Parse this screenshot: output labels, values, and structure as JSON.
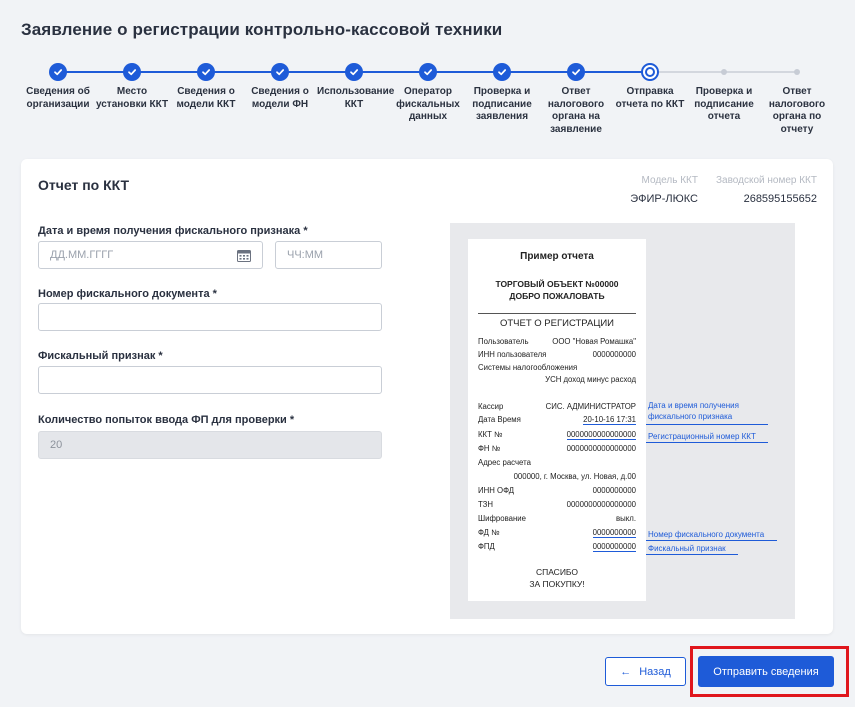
{
  "page_title": "Заявление о регистрации контрольно-кассовой техники",
  "steps": [
    {
      "label": "Сведения об организации",
      "status": "done"
    },
    {
      "label": "Место установки ККТ",
      "status": "done"
    },
    {
      "label": "Сведения о модели ККТ",
      "status": "done"
    },
    {
      "label": "Сведения о модели ФН",
      "status": "done"
    },
    {
      "label": "Использование ККТ",
      "status": "done"
    },
    {
      "label": "Оператор фискальных данных",
      "status": "done"
    },
    {
      "label": "Проверка и подписание заявления",
      "status": "done"
    },
    {
      "label": "Ответ налогового органа на заявление",
      "status": "done"
    },
    {
      "label": "Отправка отчета по ККТ",
      "status": "current"
    },
    {
      "label": "Проверка и подписание отчета",
      "status": "todo"
    },
    {
      "label": "Ответ налогового органа по отчету",
      "status": "todo"
    }
  ],
  "card": {
    "title": "Отчет по ККТ",
    "kkt_model_label": "Модель ККТ",
    "kkt_model_value": "ЭФИР-ЛЮКС",
    "serial_label": "Заводской номер ККТ",
    "serial_value": "268595155652"
  },
  "form": {
    "datetime_label": "Дата и время получения фискального признака *",
    "date_placeholder": "ДД.ММ.ГГГГ",
    "time_placeholder": "ЧЧ:ММ",
    "doc_number_label": "Номер фискального документа *",
    "fiscal_sign_label": "Фискальный признак *",
    "attempts_label": "Количество попыток ввода ФП для проверки *",
    "attempts_value": "20"
  },
  "receipt": {
    "title": "Пример отчета",
    "shop_line1": "ТОРГОВЫЙ ОБЪЕКТ №00000",
    "shop_line2": "ДОБРО ПОЖАЛОВАТЬ",
    "report_title": "ОТЧЕТ О РЕГИСТРАЦИИ",
    "user_label": "Пользователь",
    "user_value": "ООО \"Новая Ромашка\"",
    "inn_user_label": "ИНН пользователя",
    "inn_user_value": "0000000000",
    "tax_label": "Системы налогообложения",
    "tax_value": "УСН доход минус расход",
    "cashier_label": "Кассир",
    "cashier_value": "СИС. АДМИНИСТРАТОР",
    "datetime_label": "Дата Время",
    "datetime_value": "20-10-16 17:31",
    "kkt_label": "ККТ №",
    "kkt_value": "0000000000000000",
    "fn_label": "ФН №",
    "fn_value": "0000000000000000",
    "address_label": "Адрес расчета",
    "address_value": "000000, г. Москва, ул. Новая, д.00",
    "inn_ofd_label": "ИНН ОФД",
    "inn_ofd_value": "0000000000",
    "tzn_label": "ТЗН",
    "tzn_value": "0000000000000000",
    "encryption_label": "Шифрование",
    "encryption_value": "выкл.",
    "fd_label": "ФД №",
    "fd_value": "0000000000",
    "fpd_label": "ФПД",
    "fpd_value": "0000000000",
    "thanks_line1": "СПАСИБО",
    "thanks_line2": "ЗА ПОКУПКУ!"
  },
  "annotations": {
    "datetime_line1": "Дата и время получения",
    "datetime_line2": "фискального признака",
    "reg_number": "Регистрационный номер ККТ",
    "fd_number": "Номер фискального документа",
    "fiscal_sign": "Фискальный признак"
  },
  "buttons": {
    "back_arrow": "←",
    "back_label": "Назад",
    "send_label": "Отправить сведения"
  },
  "colors": {
    "accent": "#1e5bd8",
    "highlight": "#e0161c",
    "background": "#f1f3f6"
  }
}
